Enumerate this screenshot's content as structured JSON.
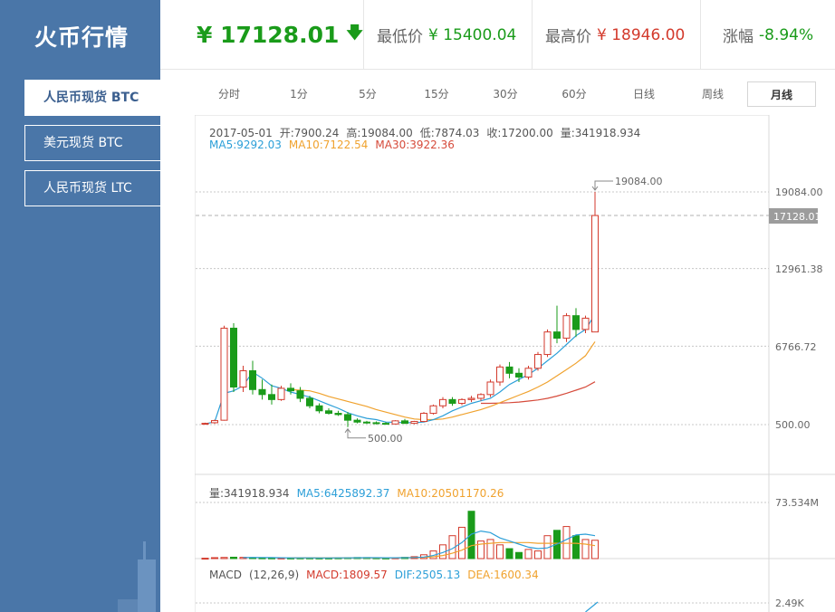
{
  "app": {
    "title": "火币行情"
  },
  "sidebar": {
    "items": [
      {
        "label": "人民币现货 BTC",
        "active": true
      },
      {
        "label": "美元现货 BTC",
        "active": false
      },
      {
        "label": "人民币现货 LTC",
        "active": false
      }
    ]
  },
  "header": {
    "price": "¥ 17128.01",
    "low_label": "最低价",
    "low_value": "¥ 15400.04",
    "high_label": "最高价",
    "high_value": "¥ 18946.00",
    "change_label": "涨幅",
    "change_value": "-8.94%"
  },
  "tabs": [
    {
      "label": "分时"
    },
    {
      "label": "1分"
    },
    {
      "label": "5分"
    },
    {
      "label": "15分"
    },
    {
      "label": "30分"
    },
    {
      "label": "60分"
    },
    {
      "label": "日线"
    },
    {
      "label": "周线"
    },
    {
      "label": "月线",
      "active": true
    }
  ],
  "colors": {
    "up": "#d33a2c",
    "down": "#1a9b1a",
    "ma5": "#2c9fd8",
    "ma10": "#f0a22e",
    "ma30": "#d64b3b",
    "sidebar": "#4a76a8"
  },
  "kline": {
    "info": {
      "date": "2017-05-01",
      "open": "开:7900.24",
      "high": "高:19084.00",
      "low": "低:7874.03",
      "close": "收:17200.00",
      "vol": "量:341918.934"
    },
    "ma": {
      "ma5": "MA5:9292.03",
      "ma10": "MA10:7122.54",
      "ma30": "MA30:3922.36"
    },
    "yaxis": [
      "19084.00",
      "12961.38",
      "6766.72",
      "500.00"
    ],
    "current_label": "17128.01",
    "max_label": "19084.00",
    "min_label": "500.00"
  },
  "volume": {
    "info": {
      "vol": "量:341918.934",
      "ma5": "MA5:6425892.37",
      "ma10": "MA10:20501170.26"
    },
    "yaxis_max": "73.534M"
  },
  "macd": {
    "info": {
      "name": "MACD",
      "params": "(12,26,9)",
      "macd": "MACD:1809.57",
      "dif": "DIF:2505.13",
      "dea": "DEA:1600.34"
    },
    "yaxis_max": "2.49K"
  },
  "chart_data": {
    "type": "candlestick",
    "ylim": [
      500,
      19084
    ],
    "candles": [
      [
        530,
        650,
        500,
        600
      ],
      [
        650,
        900,
        560,
        820
      ],
      [
        850,
        8400,
        820,
        8200
      ],
      [
        8200,
        8600,
        3100,
        3500
      ],
      [
        3500,
        5200,
        3100,
        4800
      ],
      [
        4800,
        5600,
        2900,
        3300
      ],
      [
        3300,
        4100,
        2500,
        2900
      ],
      [
        2900,
        3700,
        2100,
        2500
      ],
      [
        2500,
        3600,
        2400,
        3400
      ],
      [
        3400,
        3800,
        2900,
        3200
      ],
      [
        3200,
        3500,
        2300,
        2600
      ],
      [
        2600,
        2800,
        1800,
        2000
      ],
      [
        2000,
        2200,
        1400,
        1600
      ],
      [
        1600,
        1800,
        1300,
        1400
      ],
      [
        1400,
        1600,
        1200,
        1300
      ],
      [
        1300,
        1500,
        300,
        850
      ],
      [
        850,
        1000,
        600,
        700
      ],
      [
        700,
        800,
        550,
        650
      ],
      [
        650,
        750,
        520,
        600
      ],
      [
        600,
        700,
        520,
        550
      ],
      [
        550,
        850,
        530,
        800
      ],
      [
        800,
        950,
        550,
        600
      ],
      [
        600,
        800,
        540,
        750
      ],
      [
        750,
        1500,
        700,
        1400
      ],
      [
        1400,
        2100,
        1300,
        2000
      ],
      [
        2000,
        2700,
        1800,
        2500
      ],
      [
        2500,
        2700,
        2000,
        2200
      ],
      [
        2200,
        2600,
        2050,
        2500
      ],
      [
        2500,
        2800,
        2300,
        2600
      ],
      [
        2600,
        3000,
        2400,
        2900
      ],
      [
        2900,
        4100,
        2700,
        3900
      ],
      [
        3900,
        5300,
        3600,
        5100
      ],
      [
        5100,
        5500,
        4200,
        4600
      ],
      [
        4600,
        5000,
        3900,
        4300
      ],
      [
        4300,
        5200,
        4100,
        5000
      ],
      [
        5000,
        6300,
        4800,
        6100
      ],
      [
        6100,
        8100,
        5900,
        7900
      ],
      [
        7900,
        10000,
        7000,
        7400
      ],
      [
        7400,
        9400,
        7100,
        9200
      ],
      [
        9200,
        9800,
        7500,
        8100
      ],
      [
        8100,
        9200,
        7800,
        9000
      ],
      [
        7900,
        19084,
        7874,
        17200
      ]
    ],
    "ma5": [
      560,
      720,
      3000,
      3200,
      3600,
      4700,
      4200,
      3600,
      3400,
      3100,
      2900,
      2700,
      2400,
      2100,
      1800,
      1450,
      1200,
      1000,
      900,
      700,
      680,
      660,
      650,
      700,
      900,
      1200,
      1600,
      1900,
      2200,
      2400,
      2600,
      3100,
      3700,
      4100,
      4500,
      5000,
      5600,
      6200,
      6900,
      7600,
      8100,
      9292
    ],
    "ma10": [
      null,
      null,
      null,
      null,
      null,
      null,
      null,
      null,
      null,
      3300,
      3250,
      3200,
      3000,
      2750,
      2550,
      2350,
      2150,
      1950,
      1700,
      1500,
      1300,
      1100,
      950,
      900,
      900,
      950,
      1100,
      1300,
      1500,
      1700,
      1950,
      2250,
      2550,
      2850,
      3150,
      3500,
      3900,
      4400,
      4900,
      5400,
      6000,
      7122
    ],
    "ma30": [
      null,
      null,
      null,
      null,
      null,
      null,
      null,
      null,
      null,
      null,
      null,
      null,
      null,
      null,
      null,
      null,
      null,
      null,
      null,
      null,
      null,
      null,
      null,
      null,
      null,
      null,
      null,
      null,
      null,
      2200,
      2200,
      2220,
      2250,
      2300,
      2380,
      2470,
      2600,
      2780,
      3000,
      3250,
      3500,
      3922
    ],
    "volume": {
      "ylim": [
        0,
        73534000
      ],
      "values": [
        0.5,
        1.2,
        1.5,
        1.8,
        1.6,
        1.2,
        1.0,
        0.9,
        0.8,
        0.8,
        0.9,
        0.9,
        0.8,
        0.8,
        1.0,
        1.2,
        1.4,
        1.3,
        1.0,
        0.8,
        1.0,
        1.6,
        2.5,
        5.0,
        10.0,
        18.0,
        30.0,
        41.0,
        62.0,
        23.0,
        25.0,
        18.0,
        13.0,
        8.0,
        12.0,
        10.0,
        30.0,
        37.0,
        42.0,
        30.0,
        25.0,
        24.0
      ],
      "up": [
        true,
        true,
        true,
        false,
        true,
        false,
        false,
        false,
        true,
        false,
        false,
        false,
        false,
        false,
        false,
        false,
        false,
        false,
        false,
        false,
        true,
        false,
        true,
        true,
        true,
        true,
        true,
        true,
        false,
        true,
        true,
        true,
        false,
        false,
        true,
        true,
        true,
        false,
        true,
        false,
        true,
        true
      ],
      "ma5": [
        null,
        null,
        null,
        null,
        1.3,
        1.5,
        1.4,
        1.3,
        1.1,
        0.9,
        0.9,
        0.9,
        0.8,
        0.8,
        0.9,
        1.0,
        1.1,
        1.2,
        1.2,
        1.1,
        1.1,
        1.2,
        1.4,
        2.0,
        4.0,
        8.0,
        13.0,
        21.0,
        32.0,
        36.0,
        34.0,
        27.0,
        23.0,
        19.0,
        15.0,
        13.0,
        14.0,
        19.0,
        25.0,
        31.0,
        32.0,
        30.0
      ],
      "ma10": [
        null,
        null,
        null,
        null,
        null,
        null,
        null,
        null,
        null,
        1.1,
        1.1,
        1.1,
        1.0,
        1.0,
        1.0,
        1.0,
        1.0,
        1.1,
        1.1,
        1.1,
        1.1,
        1.2,
        1.3,
        1.6,
        2.4,
        4.0,
        7.0,
        11.0,
        17.0,
        19.0,
        20.0,
        21.0,
        21.0,
        21.0,
        21.0,
        20.0,
        20.0,
        20.0,
        20.0,
        20.0,
        19.0,
        17.0
      ]
    }
  }
}
